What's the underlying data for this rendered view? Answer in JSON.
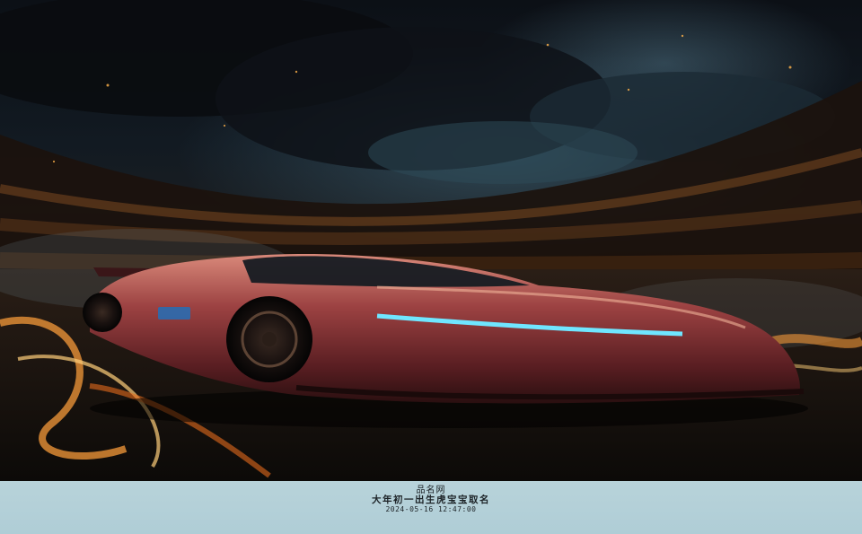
{
  "photo": {
    "subject": "car-photo",
    "badge_text": "",
    "colors": {
      "body": "#8e3a3c",
      "highlight": "#e7a58a",
      "headlight": "#6fe6ff",
      "flame": "#f59a3a",
      "caption_bg": "#b8d3da"
    }
  },
  "caption": {
    "site": "品名网",
    "name": "大年初一出生虎宝宝取名",
    "timestamp": "2024-05-16 12:47:00"
  }
}
